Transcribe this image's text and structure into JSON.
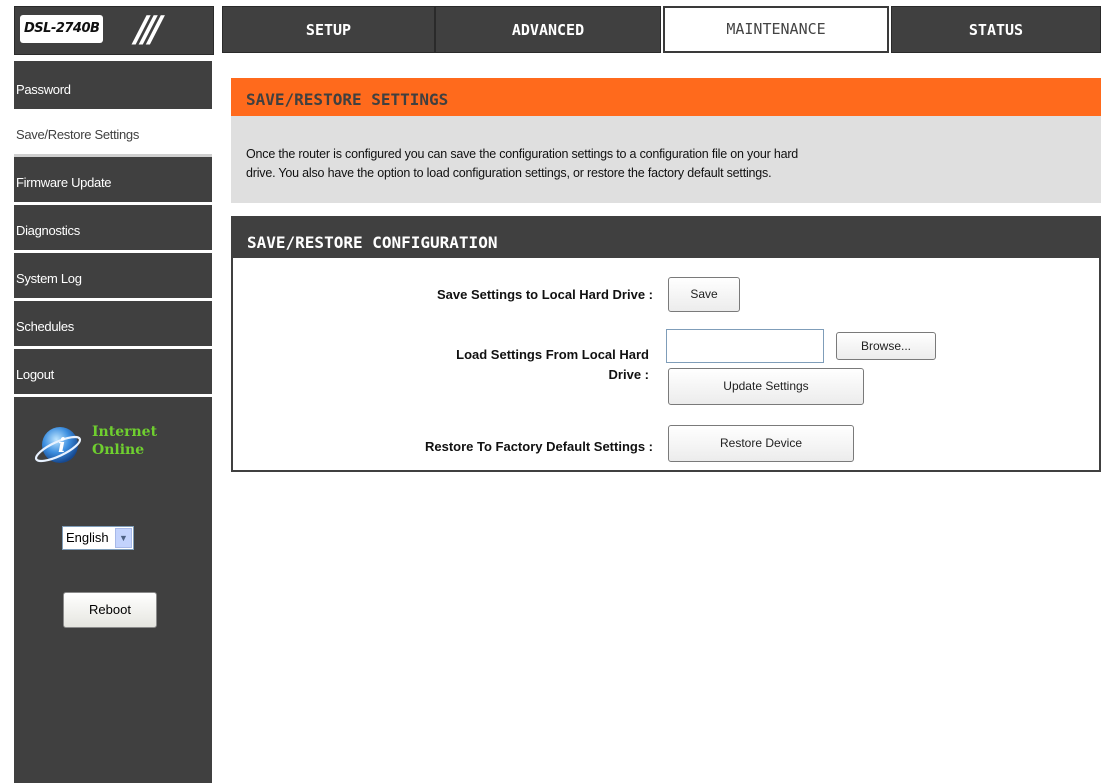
{
  "header": {
    "model": "DSL-2740B",
    "tabs": [
      {
        "label": "SETUP"
      },
      {
        "label": "ADVANCED"
      },
      {
        "label": "MAINTENANCE"
      },
      {
        "label": "STATUS"
      }
    ],
    "active_tab": "MAINTENANCE"
  },
  "sidebar": {
    "items": [
      {
        "label": "Password"
      },
      {
        "label": "Save/Restore Settings"
      },
      {
        "label": "Firmware Update"
      },
      {
        "label": "Diagnostics"
      },
      {
        "label": "System Log"
      },
      {
        "label": "Schedules"
      },
      {
        "label": "Logout"
      }
    ],
    "selected_item": "Save/Restore Settings",
    "status": {
      "line1": "Internet",
      "line2": "Online"
    },
    "language": {
      "selected": "English"
    },
    "reboot_label": "Reboot"
  },
  "main": {
    "intro": {
      "title": "SAVE/RESTORE SETTINGS",
      "line1": "Once the router is configured you can save the configuration settings to a configuration file on your hard",
      "line2": "drive. You also have the option to load configuration settings, or restore the factory default settings."
    },
    "config": {
      "title": "SAVE/RESTORE CONFIGURATION",
      "save_label": "Save Settings to Local Hard Drive :",
      "save_button": "Save",
      "load_label_line1": "Load Settings From Local Hard",
      "load_label_line2": "Drive :",
      "file_value": "",
      "browse_button": "Browse...",
      "update_button": "Update Settings",
      "restore_label": "Restore To Factory Default Settings :",
      "restore_button": "Restore Device"
    }
  },
  "colors": {
    "header_bg": "#404040",
    "accent_orange": "#ff6a1c",
    "panel_grey": "#dfdfdf",
    "status_green": "#6fcf2f"
  },
  "icons": [
    "internet-globe-icon",
    "dropdown-arrow-icon"
  ]
}
